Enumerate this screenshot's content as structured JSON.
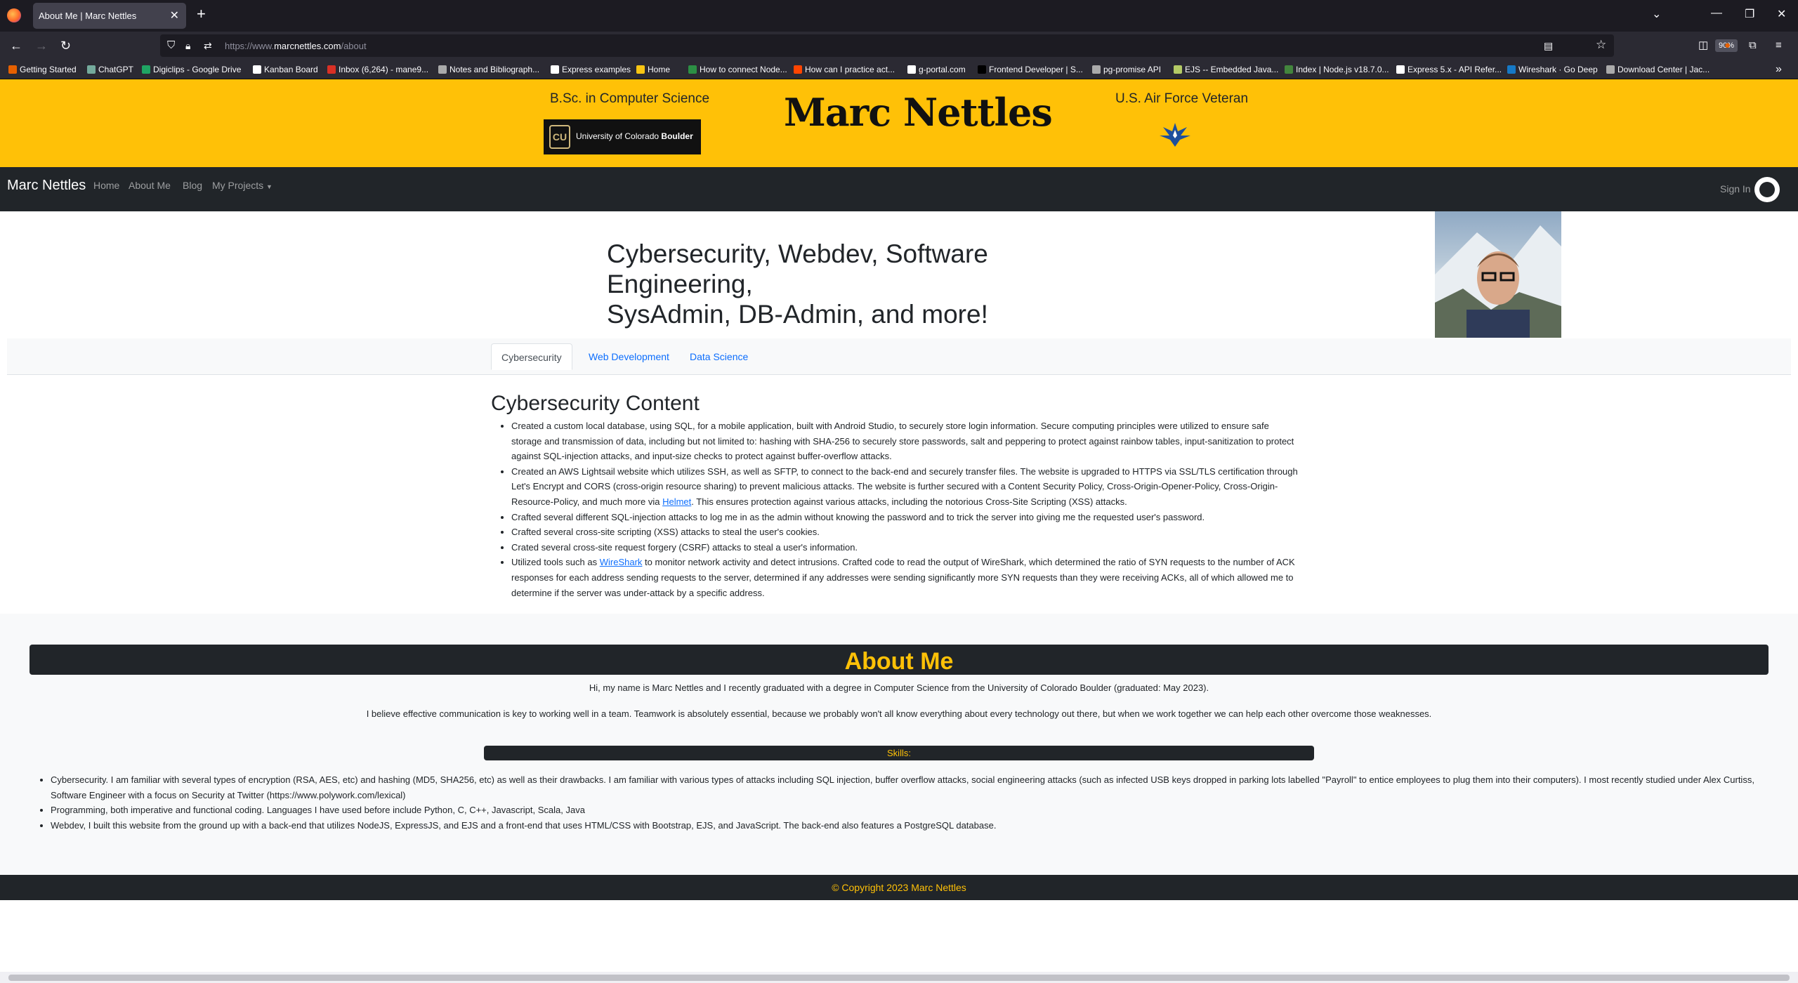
{
  "browser": {
    "tab_title": "About Me | Marc Nettles",
    "url_prefix": "https://www.",
    "url_domain": "marcnettles.com",
    "url_path": "/about",
    "zoom": "90%",
    "bookmarks": [
      {
        "label": "Getting Started",
        "color": "#e66000"
      },
      {
        "label": "ChatGPT",
        "color": "#74aa9c"
      },
      {
        "label": "Digiclips - Google Drive",
        "color": "#1fa463"
      },
      {
        "label": "Kanban Board",
        "color": "#ffffff"
      },
      {
        "label": "Inbox (6,264) - mane9...",
        "color": "#d93025"
      },
      {
        "label": "Notes and Bibliograph...",
        "color": "#aaaaaa"
      },
      {
        "label": "Express examples",
        "color": "#ffffff"
      },
      {
        "label": "Home",
        "color": "#f9c513"
      },
      {
        "label": "How to connect Node...",
        "color": "#2c8f44"
      },
      {
        "label": "How can I practice act...",
        "color": "#ff4500"
      },
      {
        "label": "g-portal.com",
        "color": "#ffffff"
      },
      {
        "label": "Frontend Developer | S...",
        "color": "#000000"
      },
      {
        "label": "pg-promise API",
        "color": "#aaaaaa"
      },
      {
        "label": "EJS -- Embedded Java...",
        "color": "#b4ca65"
      },
      {
        "label": "Index | Node.js v18.7.0...",
        "color": "#43853d"
      },
      {
        "label": "Express 5.x - API Refer...",
        "color": "#ffffff"
      },
      {
        "label": "Wireshark · Go Deep",
        "color": "#1679c6"
      },
      {
        "label": "Download Center | Jac...",
        "color": "#aaaaaa"
      }
    ]
  },
  "hero": {
    "left_caption": "B.Sc. in Computer Science",
    "cu_logo": "CU",
    "cu_text_light": "University of Colorado",
    "cu_text_bold": "Boulder",
    "title": "Marc Nettles",
    "right_caption": "U.S. Air Force Veteran"
  },
  "nav": {
    "brand": "Marc Nettles",
    "links": [
      "Home",
      "About Me",
      "Blog",
      "My Projects"
    ],
    "signin": "Sign In"
  },
  "intro": {
    "heading_line1": "Cybersecurity, Webdev, Software Engineering,",
    "heading_line2": "SysAdmin, DB-Admin, and more!"
  },
  "content_tabs": [
    "Cybersecurity",
    "Web Development",
    "Data Science"
  ],
  "cyber": {
    "heading": "Cybersecurity Content",
    "items": [
      {
        "text": "Created a custom local database, using SQL, for a mobile application, built with Android Studio, to securely store login information. Secure computing principles were utilized to ensure safe storage and transmission of data, including but not limited to: hashing with SHA-256 to securely store passwords, salt and peppering to protect against rainbow tables, input-sanitization to protect against SQL-injection attacks, and input-size checks to protect against buffer-overflow attacks."
      },
      {
        "text_a": "Created an AWS Lightsail website which utilizes SSH, as well as SFTP, to connect to the back-end and securely transfer files. The website is upgraded to HTTPS via SSL/TLS certification through Let's Encrypt and CORS (cross-origin resource sharing) to prevent malicious attacks. The website is further secured with a Content Security Policy, Cross-Origin-Opener-Policy, Cross-Origin-Resource-Policy, and much more via ",
        "link": "Helmet",
        "text_b": ". This ensures protection against various attacks, including the notorious Cross-Site Scripting (XSS) attacks."
      },
      {
        "text": "Crafted several different SQL-injection attacks to log me in as the admin without knowing the password and to trick the server into giving me the requested user's password."
      },
      {
        "text": "Crafted several cross-site scripting (XSS) attacks to steal the user's cookies."
      },
      {
        "text": "Crated several cross-site request forgery (CSRF) attacks to steal a user's information."
      },
      {
        "text_a": "Utilized tools such as ",
        "link": "WireShark",
        "text_b": " to monitor network activity and detect intrusions. Crafted code to read the output of WireShark, which determined the ratio of SYN requests to the number of ACK responses for each address sending requests to the server, determined if any addresses were sending significantly more SYN requests than they were receiving ACKs, all of which allowed me to determine if the server was under-attack by a specific address."
      }
    ]
  },
  "about": {
    "title": "About Me",
    "para1": "Hi, my name is Marc Nettles and I recently graduated with a degree in Computer Science from the University of Colorado Boulder (graduated: May 2023).",
    "para2": "I believe effective communication is key to working well in a team. Teamwork is absolutely essential, because we probably won't all know everything about every technology out there, but when we work together we can help each other overcome those weaknesses.",
    "skills_title": "Skills:",
    "skills": [
      "Cybersecurity. I am familiar with several types of encryption (RSA, AES, etc) and hashing (MD5, SHA256, etc) as well as their drawbacks. I am familiar with various types of attacks including SQL injection, buffer overflow attacks, social engineering attacks (such as infected USB keys dropped in parking lots labelled \"Payroll\" to entice employees to plug them into their computers). I most recently studied under Alex Curtiss, Software Engineer with a focus on Security at Twitter (https://www.polywork.com/lexical)",
      "Programming, both imperative and functional coding. Languages I have used before include Python, C, C++, Javascript, Scala, Java",
      "Webdev, I built this website from the ground up with a back-end that utilizes NodeJS, ExpressJS, and EJS and a front-end that uses HTML/CSS with Bootstrap, EJS, and JavaScript. The back-end also features a PostgreSQL database."
    ]
  },
  "footer": {
    "text": "© Copyright 2023 Marc Nettles"
  },
  "colors": {
    "accent": "#ffc107",
    "dark": "#212529",
    "link": "#0d6efd"
  }
}
